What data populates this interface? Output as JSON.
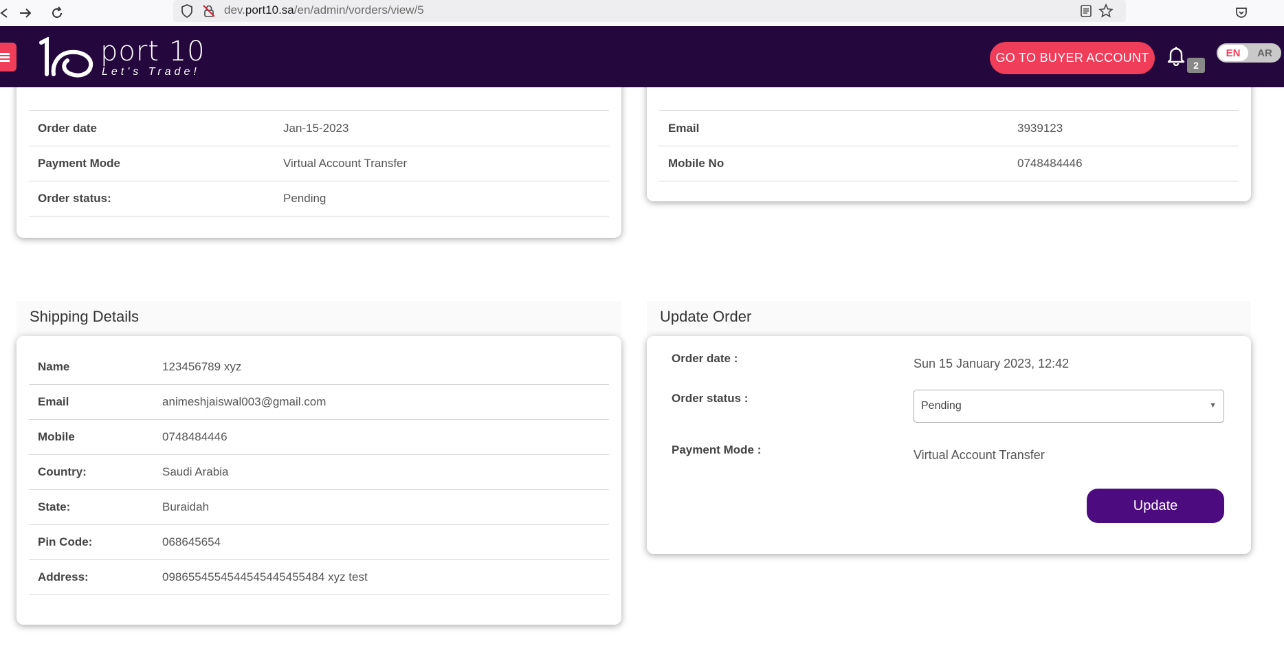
{
  "browser": {
    "url_prefix": "dev.",
    "url_host": "port10.sa",
    "url_path": "/en/admin/vorders/view/5"
  },
  "header": {
    "logo_word": "port 10",
    "logo_tagline": "Let's Trade!",
    "buyer_button": "GO TO BUYER ACCOUNT",
    "notification_count": "2",
    "lang_en": "EN",
    "lang_ar": "AR",
    "brand_color": "#24073d",
    "accent_color": "#ef3d5a"
  },
  "order_details": {
    "rows": [
      {
        "label": "Order date",
        "value": "Jan-15-2023"
      },
      {
        "label": "Payment Mode",
        "value": "Virtual Account Transfer"
      },
      {
        "label": "Order status:",
        "value": "Pending"
      }
    ]
  },
  "customer_details": {
    "rows": [
      {
        "label": "Email",
        "value": "3939123"
      },
      {
        "label": "Mobile No",
        "value": "0748484446"
      }
    ]
  },
  "shipping": {
    "title": "Shipping Details",
    "rows": [
      {
        "label": "Name",
        "value": "123456789 xyz"
      },
      {
        "label": "Email",
        "value": "animeshjaiswal003@gmail.com"
      },
      {
        "label": "Mobile",
        "value": "0748484446"
      },
      {
        "label": "Country:",
        "value": "Saudi Arabia"
      },
      {
        "label": "State:",
        "value": "Buraidah"
      },
      {
        "label": "Pin Code:",
        "value": "068645654"
      },
      {
        "label": "Address:",
        "value": "0986554554544545445455484 xyz test"
      }
    ]
  },
  "update_order": {
    "title": "Update Order",
    "order_date_label": "Order date :",
    "order_date_value": "Sun 15 January 2023, 12:42",
    "order_status_label": "Order status :",
    "order_status_selected": "Pending",
    "payment_mode_label": "Payment Mode :",
    "payment_mode_value": "Virtual Account Transfer",
    "update_button": "Update",
    "button_color": "#4c0b7e"
  }
}
